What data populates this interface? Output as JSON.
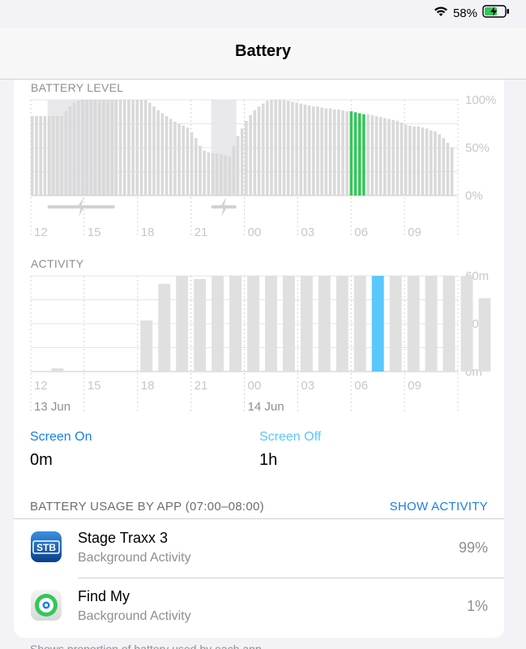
{
  "status_bar": {
    "battery_percent": "58%"
  },
  "nav": {
    "title": "Battery"
  },
  "battery_chart": {
    "label": "BATTERY LEVEL",
    "y_ticks": [
      "100%",
      "50%",
      "0%"
    ],
    "x_ticks": [
      "12",
      "15",
      "18",
      "21",
      "00",
      "03",
      "06",
      "09"
    ]
  },
  "activity_chart": {
    "label": "ACTIVITY",
    "y_ticks": [
      "60m",
      "30m",
      "0m"
    ],
    "x_ticks": [
      "12",
      "15",
      "18",
      "21",
      "00",
      "03",
      "06",
      "09"
    ],
    "date_labels": [
      "13 Jun",
      "14 Jun"
    ]
  },
  "chart_data": [
    {
      "type": "bar",
      "title": "BATTERY LEVEL",
      "x_tick_labels": [
        "12",
        "15",
        "18",
        "21",
        "00",
        "03",
        "06",
        "09"
      ],
      "ylim": [
        0,
        100
      ],
      "y_unit": "%",
      "bar_interval_minutes": 15,
      "start_tick": "12",
      "values": [
        83,
        83,
        83,
        83,
        83,
        83,
        83,
        83,
        88,
        93,
        97,
        99,
        100,
        100,
        100,
        100,
        100,
        100,
        100,
        100,
        100,
        100,
        100,
        100,
        100,
        100,
        100,
        100,
        97,
        93,
        89,
        86,
        83,
        80,
        77,
        75,
        73,
        71,
        66,
        60,
        52,
        47,
        45,
        44,
        44,
        43,
        42,
        41,
        52,
        62,
        70,
        78,
        84,
        89,
        93,
        96,
        99,
        100,
        100,
        100,
        100,
        99,
        98,
        97,
        96,
        95,
        94,
        93,
        93,
        92,
        91,
        91,
        90,
        90,
        89,
        88,
        88,
        87,
        86,
        85,
        85,
        84,
        83,
        82,
        81,
        80,
        79,
        78,
        76,
        74,
        73,
        72,
        72,
        71,
        70,
        68,
        67,
        64,
        60,
        55,
        50
      ],
      "highlight_range": [
        "07:00",
        "08:00"
      ],
      "highlight_color": "#34c759",
      "bar_color": "#d9d9d9",
      "charging_periods": [
        [
          "13:00",
          "17:00"
        ],
        [
          "22:45",
          "00:15"
        ]
      ]
    },
    {
      "type": "bar",
      "title": "ACTIVITY",
      "x_tick_labels": [
        "12",
        "15",
        "18",
        "21",
        "00",
        "03",
        "06",
        "09"
      ],
      "date_labels": [
        "13 Jun",
        "14 Jun"
      ],
      "ylim": [
        0,
        60
      ],
      "y_unit": "minutes",
      "bar_interval_minutes": 60,
      "start_tick": "12",
      "values": [
        0,
        2,
        0,
        0,
        0,
        0,
        32,
        55,
        60,
        58,
        60,
        60,
        60,
        60,
        60,
        60,
        60,
        60,
        60,
        60,
        60,
        60,
        60,
        60,
        60,
        46
      ],
      "highlight_range": [
        "07:00",
        "08:00"
      ],
      "highlight_color": "#5ac8fa",
      "bar_color": "#e0e0e0"
    }
  ],
  "legend": {
    "screen_on": {
      "label": "Screen On",
      "value": "0m",
      "color": "#1a7ee6"
    },
    "screen_off": {
      "label": "Screen Off",
      "value": "1h",
      "color": "#5ac8fa"
    }
  },
  "usage": {
    "title": "BATTERY USAGE BY APP (07:00–08:00)",
    "show_activity": "SHOW ACTIVITY",
    "apps": [
      {
        "name": "Stage Traxx 3",
        "subtitle": "Background Activity",
        "percent": "99%",
        "icon": "stage-traxx-icon",
        "icon_text": "STB"
      },
      {
        "name": "Find My",
        "subtitle": "Background Activity",
        "percent": "1%",
        "icon": "find-my-icon"
      }
    ]
  },
  "footer": {
    "note": "Shows proportion of battery used by each app"
  }
}
